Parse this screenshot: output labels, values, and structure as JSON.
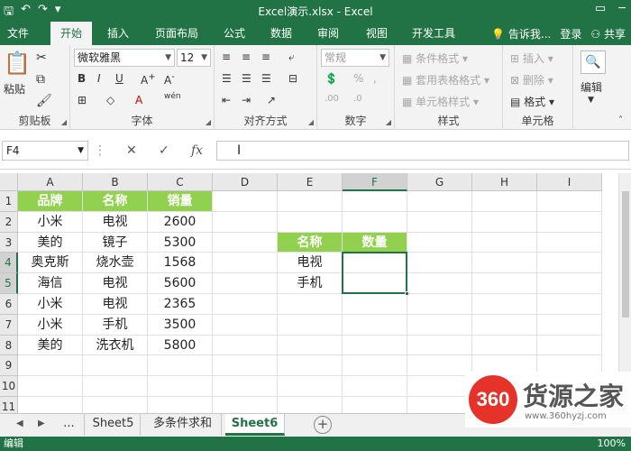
{
  "window": {
    "title": "Excel演示.xlsx - Excel"
  },
  "tabs": [
    "文件",
    "开始",
    "插入",
    "页面布局",
    "公式",
    "数据",
    "审阅",
    "视图",
    "开发工具"
  ],
  "tab_right": {
    "tell_me": "告诉我...",
    "login": "登录",
    "share": "共享"
  },
  "ribbon": {
    "clipboard": {
      "paste": "粘贴",
      "label": "剪贴板"
    },
    "font": {
      "name": "微软雅黑",
      "size": "12",
      "label": "字体"
    },
    "alignment": {
      "label": "对齐方式"
    },
    "number": {
      "format": "常规",
      "label": "数字"
    },
    "styles": {
      "conditional": "条件格式",
      "table": "套用表格格式",
      "cell": "单元格样式",
      "label": "样式"
    },
    "cells": {
      "insert": "插入",
      "delete": "删除",
      "format": "格式",
      "label": "单元格"
    },
    "editing": {
      "label": "编辑"
    }
  },
  "formula_bar": {
    "name_box": "F4",
    "value": ""
  },
  "columns": [
    "A",
    "B",
    "C",
    "D",
    "E",
    "F",
    "G",
    "H",
    "I"
  ],
  "rows": [
    "1",
    "2",
    "3",
    "4",
    "5",
    "6",
    "7",
    "8",
    "9",
    "10",
    "11"
  ],
  "table1": {
    "headers": [
      "品牌",
      "名称",
      "销量"
    ],
    "rows": [
      [
        "小米",
        "电视",
        "2600"
      ],
      [
        "美的",
        "镜子",
        "5300"
      ],
      [
        "奥克斯",
        "烧水壶",
        "1568"
      ],
      [
        "海信",
        "电视",
        "5600"
      ],
      [
        "小米",
        "电视",
        "2365"
      ],
      [
        "小米",
        "手机",
        "3500"
      ],
      [
        "美的",
        "洗衣机",
        "5800"
      ]
    ]
  },
  "table2": {
    "headers": [
      "名称",
      "数量"
    ],
    "rows": [
      [
        "电视",
        ""
      ],
      [
        "手机",
        ""
      ]
    ]
  },
  "sheets": {
    "more": "...",
    "items": [
      "Sheet5",
      "多条件求和",
      "Sheet6"
    ],
    "active": "Sheet6"
  },
  "status": {
    "mode": "编辑",
    "zoom": "100%"
  },
  "watermark": {
    "logo": "360",
    "name": "货源之家",
    "url": "www.360hyzj.com"
  }
}
